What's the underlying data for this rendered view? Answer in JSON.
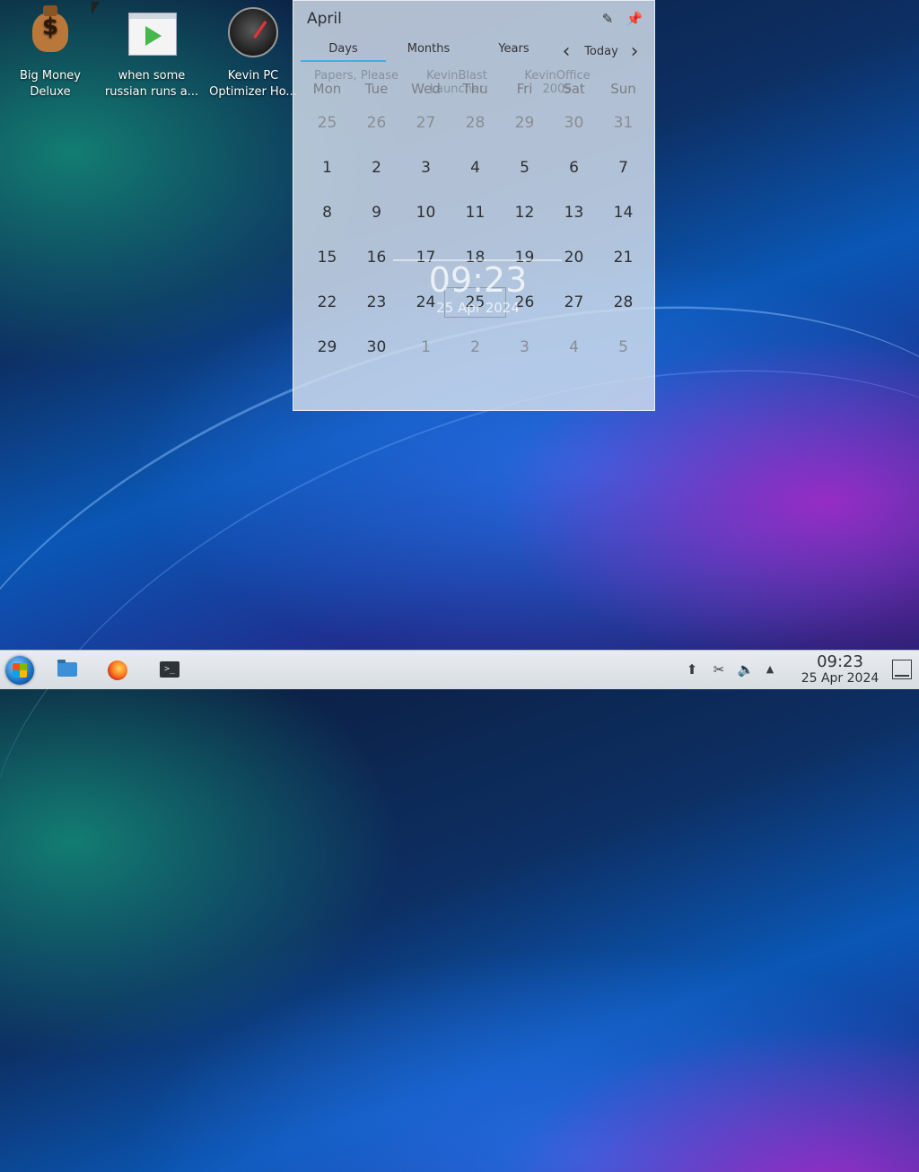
{
  "desktop": {
    "icons": [
      {
        "label1": "Big Money",
        "label2": "Deluxe",
        "icon": "money-bag-icon"
      },
      {
        "label1": "when some",
        "label2": "russian runs a...",
        "icon": "video-player-icon"
      },
      {
        "label1": "Kevin PC",
        "label2": "Optimizer Ho...",
        "icon": "speed-gauge-icon"
      }
    ],
    "ghost_icons": [
      {
        "label1": "Papers, Please",
        "label2": ""
      },
      {
        "label1": "KevinBlast",
        "label2": "Launcher"
      },
      {
        "label1": "KevinOffice",
        "label2": "2005"
      }
    ],
    "ghost_clock": {
      "time": "09:23",
      "date": "25 Apr 2024"
    }
  },
  "calendar": {
    "month": "April",
    "tabs": [
      "Days",
      "Months",
      "Years"
    ],
    "active_tab": "Days",
    "today_label": "Today",
    "weekdays": [
      "Mon",
      "Tue",
      "Wed",
      "Thu",
      "Fri",
      "Sat",
      "Sun"
    ],
    "weeks": [
      [
        "25",
        "26",
        "27",
        "28",
        "29",
        "30",
        "31"
      ],
      [
        "1",
        "2",
        "3",
        "4",
        "5",
        "6",
        "7"
      ],
      [
        "8",
        "9",
        "10",
        "11",
        "12",
        "13",
        "14"
      ],
      [
        "15",
        "16",
        "17",
        "18",
        "19",
        "20",
        "21"
      ],
      [
        "22",
        "23",
        "24",
        "25",
        "26",
        "27",
        "28"
      ],
      [
        "29",
        "30",
        "1",
        "2",
        "3",
        "4",
        "5"
      ]
    ],
    "selected_day": "25"
  },
  "taskbar": {
    "time": "09:23",
    "date": "25 Apr 2024",
    "launchers": [
      "start-menu-icon",
      "file-manager-icon",
      "firefox-icon",
      "terminal-icon"
    ],
    "tray": [
      "updates-icon",
      "scissors-icon",
      "volume-icon",
      "expand-tray-icon"
    ]
  }
}
